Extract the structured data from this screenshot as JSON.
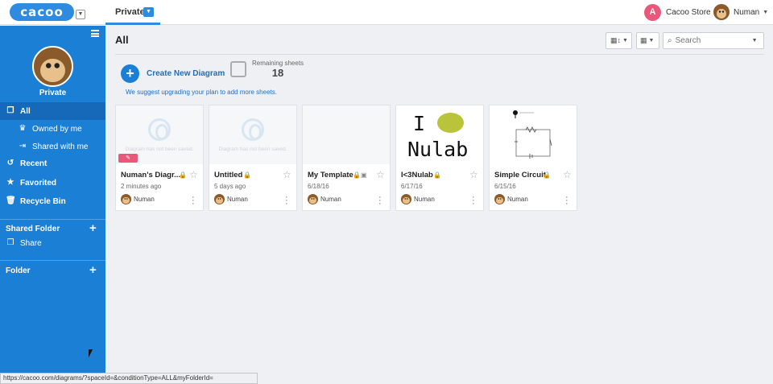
{
  "app": {
    "logo_text": "cacoo"
  },
  "header": {
    "space_tab": "Private",
    "store_label": "Cacoo Store",
    "user_name": "Numan"
  },
  "sidebar": {
    "space_name": "Private",
    "nav": [
      {
        "label": "All",
        "icon": "all-diagrams-icon",
        "active": true
      },
      {
        "label": "Owned by me",
        "icon": "crown-icon"
      },
      {
        "label": "Shared with me",
        "icon": "shared-user-icon"
      },
      {
        "label": "Recent",
        "icon": "history-icon"
      },
      {
        "label": "Favorited",
        "icon": "star-icon"
      },
      {
        "label": "Recycle Bin",
        "icon": "trash-icon"
      }
    ],
    "shared_folder": {
      "title": "Shared Folder",
      "items": [
        {
          "label": "Share"
        }
      ]
    },
    "folder": {
      "title": "Folder"
    }
  },
  "main": {
    "title": "All",
    "search_placeholder": "Search",
    "create_label": "Create New Diagram",
    "remaining_label": "Remaining sheets",
    "remaining_count": "18",
    "upgrade_text": "We suggest upgrading your plan to add more sheets.",
    "unsaved_text": "Diagram has not been saved.",
    "cards": [
      {
        "name": "Numan's Diagr...",
        "date": "2 minutes ago",
        "owner": "Numan",
        "thumb": "unsaved",
        "editing": true
      },
      {
        "name": "Untitled",
        "date": "5 days ago",
        "owner": "Numan",
        "thumb": "unsaved"
      },
      {
        "name": "My Template",
        "date": "6/18/16",
        "owner": "Numan",
        "thumb": "blank",
        "template": true
      },
      {
        "name": "I<3Nulab",
        "date": "6/17/16",
        "owner": "Numan",
        "thumb": "nulab"
      },
      {
        "name": "Simple Circuit",
        "date": "6/15/16",
        "owner": "Numan",
        "thumb": "circuit"
      }
    ],
    "nulab_thumb": {
      "line1": "I",
      "line2": "Nulab"
    }
  },
  "statusbar": {
    "url": "https://cacoo.com/diagrams/?spaceId=&conditionType=ALL&myFolderId="
  }
}
